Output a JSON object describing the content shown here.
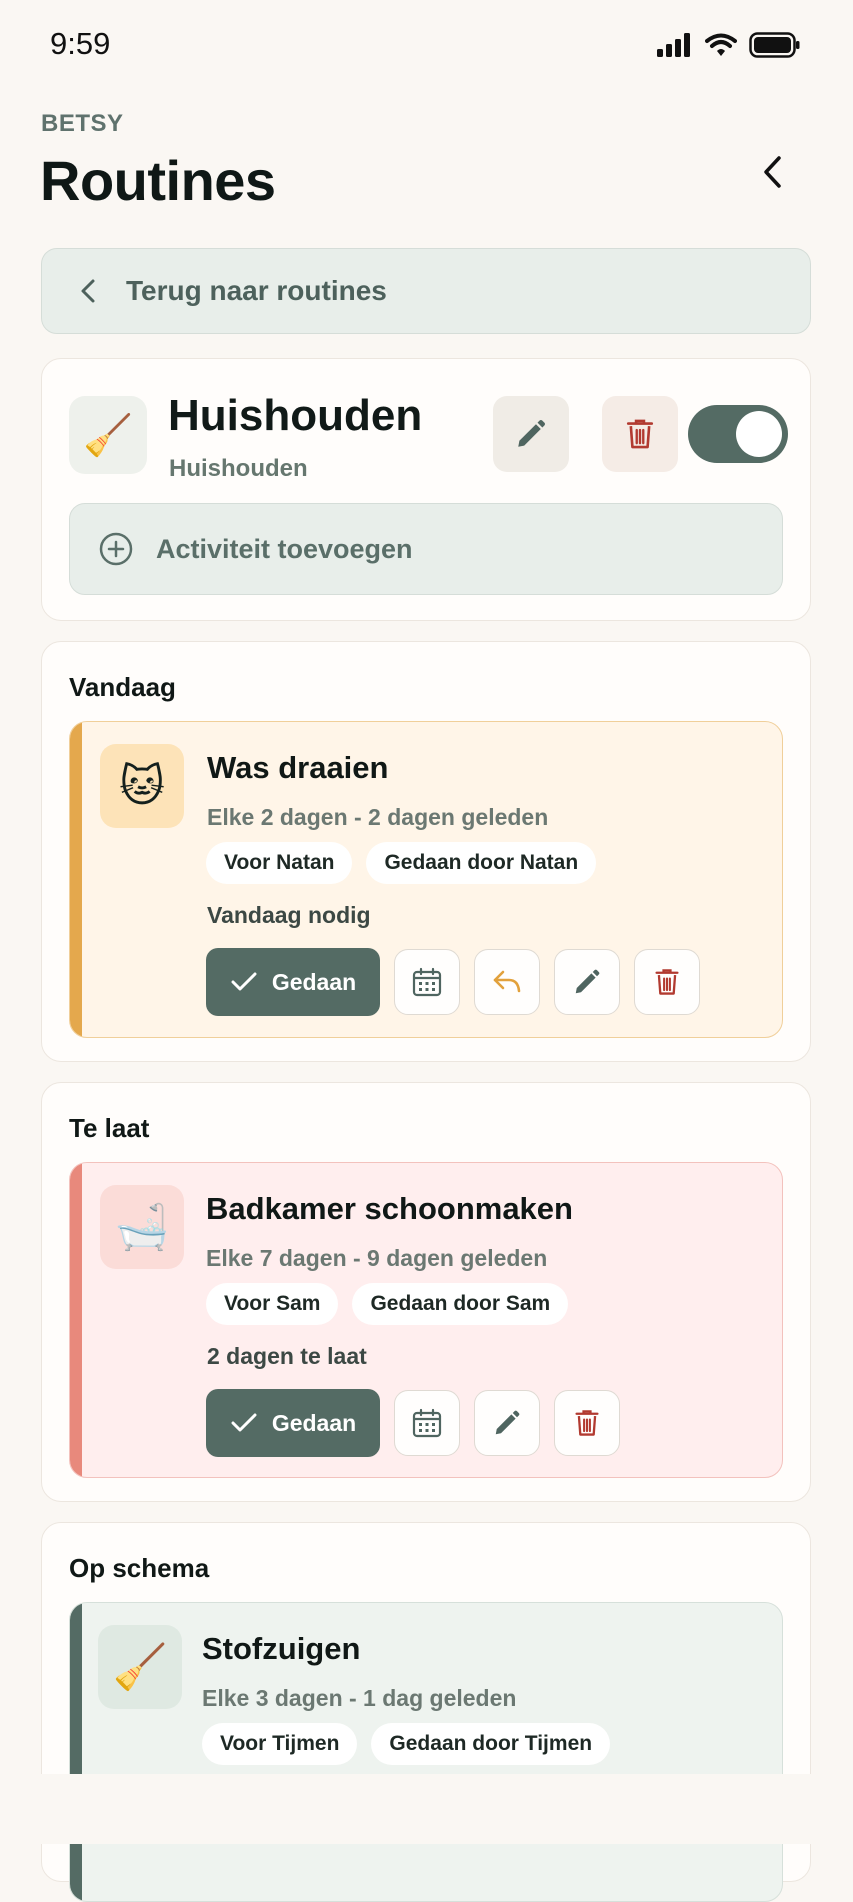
{
  "status_bar": {
    "time": "9:59"
  },
  "header": {
    "kicker": "BETSY",
    "title": "Routines"
  },
  "back_bar": {
    "label": "Terug naar routines"
  },
  "routine": {
    "icon": "broom-icon",
    "name": "Huishouden",
    "category": "Huishouden",
    "enabled": true,
    "add_label": "Activiteit toevoegen"
  },
  "sections": [
    {
      "title": "Vandaag",
      "tasks": [
        {
          "icon": "cat-face-icon",
          "title": "Was draaien",
          "meta": "Elke 2 dagen - 2 dagen geleden",
          "chips": [
            "Voor Natan",
            "Gedaan door Natan"
          ],
          "status": "Vandaag nodig",
          "done_label": "Gedaan",
          "accent": "#e4a84d"
        }
      ]
    },
    {
      "title": "Te laat",
      "tasks": [
        {
          "icon": "bathtub-icon",
          "title": "Badkamer schoonmaken",
          "meta": "Elke 7 dagen - 9 dagen geleden",
          "chips": [
            "Voor Sam",
            "Gedaan door Sam"
          ],
          "status": "2 dagen te laat",
          "done_label": "Gedaan",
          "accent": "#e8897c"
        }
      ]
    },
    {
      "title": "Op schema",
      "tasks": [
        {
          "icon": "broom-icon",
          "title": "Stofzuigen",
          "meta": "Elke 3 dagen - 1 dag geleden",
          "chips": [
            "Voor Tijmen",
            "Gedaan door Tijmen"
          ],
          "accent": "#546b64"
        }
      ]
    }
  ],
  "colors": {
    "primary": "#546b64",
    "today_bg": "#fff5e8",
    "overdue_bg": "#ffeeee",
    "on_schedule_bg": "#eef3ef",
    "danger": "#b23a30"
  }
}
